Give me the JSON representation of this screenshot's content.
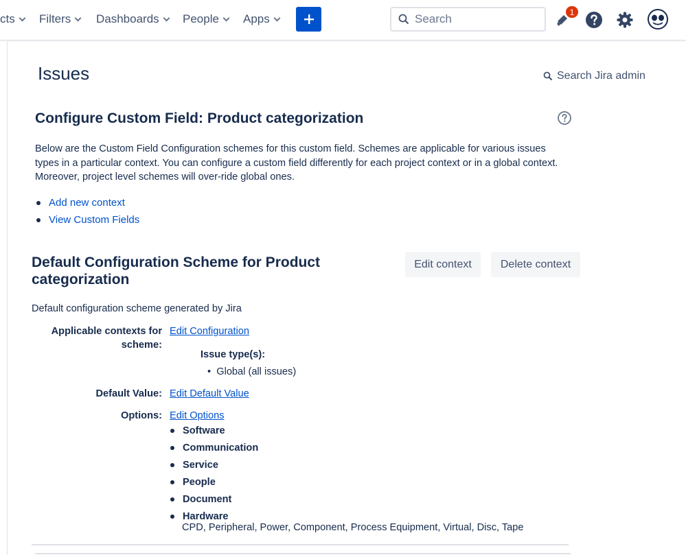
{
  "nav": {
    "items": [
      {
        "label": "cts"
      },
      {
        "label": "Filters"
      },
      {
        "label": "Dashboards"
      },
      {
        "label": "People"
      },
      {
        "label": "Apps"
      }
    ],
    "search_placeholder": "Search",
    "notification_count": "1"
  },
  "page": {
    "title": "Issues",
    "admin_search": "Search Jira admin"
  },
  "field": {
    "title": "Configure Custom Field: Product categorization",
    "description": "Below are the Custom Field Configuration schemes for this custom field. Schemes are applicable for various issues types in a particular context. You can configure a custom field differently for each project context or in a global context. Moreover, project level schemes will over-ride global ones.",
    "links": [
      "Add new context",
      "View Custom Fields"
    ]
  },
  "scheme": {
    "title": "Default Configuration Scheme for Product categorization",
    "edit_context": "Edit context",
    "delete_context": "Delete context",
    "description": "Default configuration scheme generated by Jira",
    "contexts_label": "Applicable contexts for scheme:",
    "edit_configuration": "Edit Configuration",
    "issue_types_label": "Issue type(s):",
    "issue_types_value": "Global (all issues)",
    "default_value_label": "Default Value:",
    "edit_default_value": "Edit Default Value",
    "options_label": "Options:",
    "edit_options": "Edit Options",
    "options": [
      "Software",
      "Communication",
      "Service",
      "People",
      "Document",
      "Hardware"
    ],
    "hardware_suboptions": "CPD, Peripheral, Power, Component, Process Equipment, Virtual, Disc, Tape"
  },
  "colors": {
    "brand": "#0052cc",
    "text": "#172b4d",
    "badge": "#de350b"
  }
}
